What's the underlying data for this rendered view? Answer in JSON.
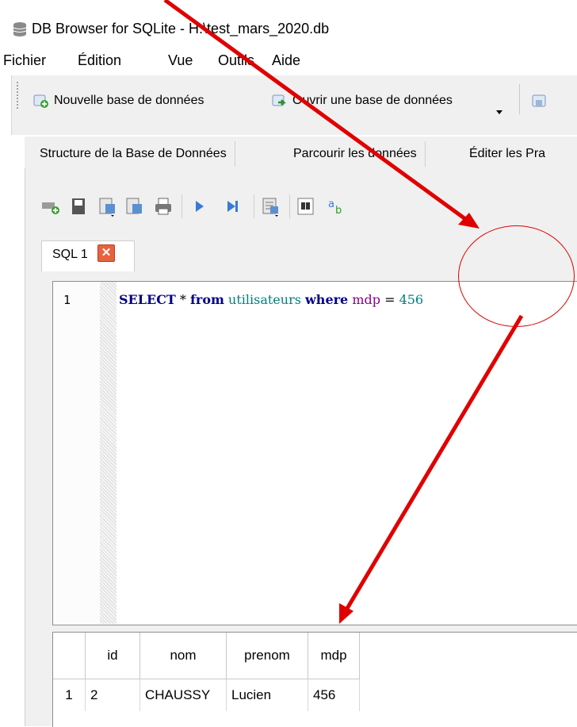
{
  "window": {
    "title": "DB Browser for SQLite - H:\\test_mars_2020.db",
    "app_icon": "database-icon"
  },
  "menu": [
    "Fichier",
    "Édition",
    "Vue",
    "Outils",
    "Aide"
  ],
  "toolbar": {
    "new_db": "Nouvelle base de données",
    "open_db": "Ouvrir une base de données"
  },
  "tabs": [
    "Structure de la Base de Données",
    "Parcourir les données",
    "Éditer les Pra"
  ],
  "sql_tab": {
    "label": "SQL 1",
    "close": "✕"
  },
  "editor": {
    "line_number": "1",
    "tokens": {
      "select": "SELECT",
      "star": " * ",
      "from": "from",
      "table": "utilisateurs",
      "where": "where",
      "column": "mdp",
      "eq": " = ",
      "value": "456"
    }
  },
  "results": {
    "columns": [
      "id",
      "nom",
      "prenom",
      "mdp"
    ],
    "rows": [
      {
        "row_number": "1",
        "cells": [
          "2",
          "CHAUSSY",
          "Lucien",
          "456"
        ]
      }
    ]
  },
  "colors": {
    "annotation": "#e00000",
    "keyword": "#00008b",
    "identifier": "#008080",
    "column": "#8b008b"
  }
}
